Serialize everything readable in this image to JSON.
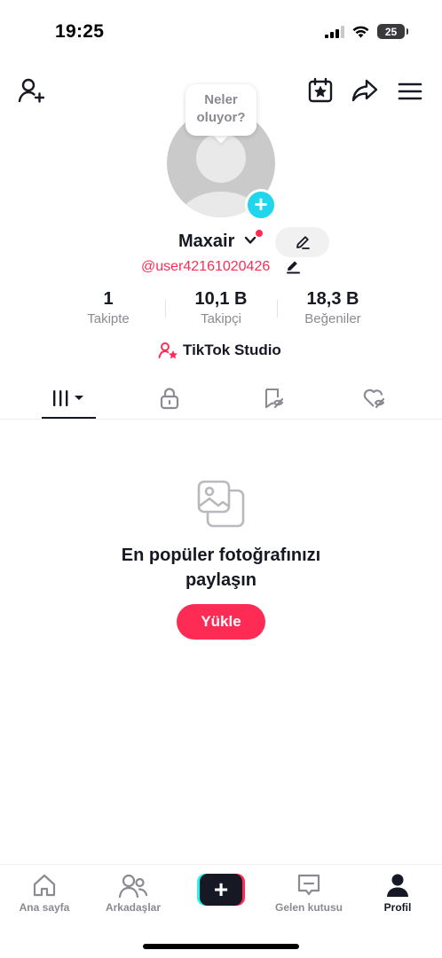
{
  "status_bar": {
    "time": "19:25",
    "battery": "25"
  },
  "bubble": {
    "line1": "Neler",
    "line2": "oluyor?"
  },
  "profile": {
    "name": "Maxair",
    "handle": "@user42161020426"
  },
  "stats": [
    {
      "value": "1",
      "label": "Takipte"
    },
    {
      "value": "10,1 B",
      "label": "Takipçi"
    },
    {
      "value": "18,3 B",
      "label": "Beğeniler"
    }
  ],
  "studio": {
    "label": "TikTok Studio"
  },
  "empty_state": {
    "line1": "En popüler fotoğrafınızı",
    "line2": "paylaşın",
    "button": "Yükle"
  },
  "nav": [
    {
      "label": "Ana sayfa",
      "icon": "home-icon"
    },
    {
      "label": "Arkadaşlar",
      "icon": "friends-icon"
    },
    {
      "label": "",
      "icon": "create-icon"
    },
    {
      "label": "Gelen kutusu",
      "icon": "inbox-icon"
    },
    {
      "label": "Profil",
      "icon": "profile-icon"
    }
  ],
  "colors": {
    "accent": "#fe2c55",
    "cyan": "#20d5ec",
    "text": "#161823",
    "muted": "#8a8b91"
  }
}
